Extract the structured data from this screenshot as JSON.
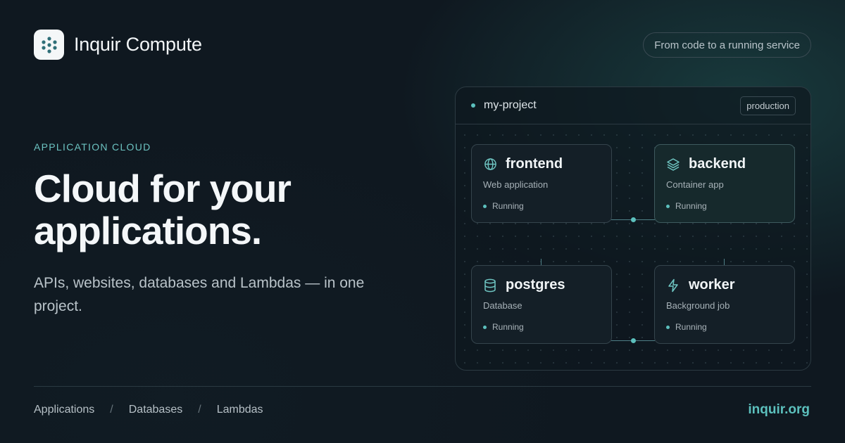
{
  "brand": {
    "name": "Inquir Compute",
    "logo_icon": "dots-cluster-logo"
  },
  "header": {
    "tagline": "From code to a running service"
  },
  "hero": {
    "eyebrow": "APPLICATION CLOUD",
    "headline": "Cloud for your applications.",
    "subline": "APIs, websites, databases and Lambdas — in one project."
  },
  "project": {
    "name": "my-project",
    "environment": "production",
    "services": [
      {
        "name": "frontend",
        "type": "Web application",
        "status": "Running",
        "icon": "globe-icon"
      },
      {
        "name": "backend",
        "type": "Container app",
        "status": "Running",
        "icon": "layers-icon"
      },
      {
        "name": "postgres",
        "type": "Database",
        "status": "Running",
        "icon": "database-icon"
      },
      {
        "name": "worker",
        "type": "Background job",
        "status": "Running",
        "icon": "bolt-icon"
      }
    ]
  },
  "footer": {
    "nav": [
      "Applications",
      "Databases",
      "Lambdas"
    ],
    "separator": "/",
    "site": "inquir.org"
  },
  "colors": {
    "accent": "#5cc0bd",
    "background": "#0f1820"
  }
}
